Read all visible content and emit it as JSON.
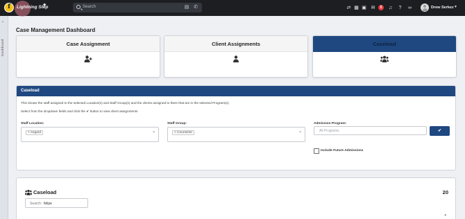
{
  "app": {
    "brand": "Lightning Step",
    "logo_letter": "f"
  },
  "topbar": {
    "search_placeholder": "Search",
    "notification_count": "5",
    "user_name": "Drew Serkez"
  },
  "rail": {
    "label": "Dashboard"
  },
  "page": {
    "title": "Case Management Dashboard"
  },
  "cards": [
    {
      "label": "Case Assignment",
      "icon": "user-plus-icon",
      "active": false
    },
    {
      "label": "Client Assignments",
      "icon": "user-icon",
      "active": false
    },
    {
      "label": "Caseload",
      "icon": "users-icon",
      "active": true
    }
  ],
  "caseload_panel": {
    "header": "Caseload",
    "description1": "This shows the staff assigned to the selected Location(s) and Staff Group(s) and the clients assigned to them that are in the selected Program(s).",
    "description2_prefix": "Select from the dropdown fields and click the",
    "description2_suffix": "button to view client assignments",
    "staff_location_label": "Staff Location:",
    "staff_location_value": "Asgard",
    "staff_group_label": "Staff Group:",
    "staff_group_value": "Counselor",
    "admission_program_label": "Admission Program:",
    "admission_program_placeholder": "All Programs",
    "include_future_label": "Include Future Admissions",
    "include_future_checked": false
  },
  "caseload_results": {
    "title": "Caseload",
    "count": "20",
    "search_label": "Search:",
    "search_value": "felipe"
  },
  "colors": {
    "topbar": "#1c1e22",
    "accent": "#1f4880",
    "logo": "#f2c21b"
  }
}
